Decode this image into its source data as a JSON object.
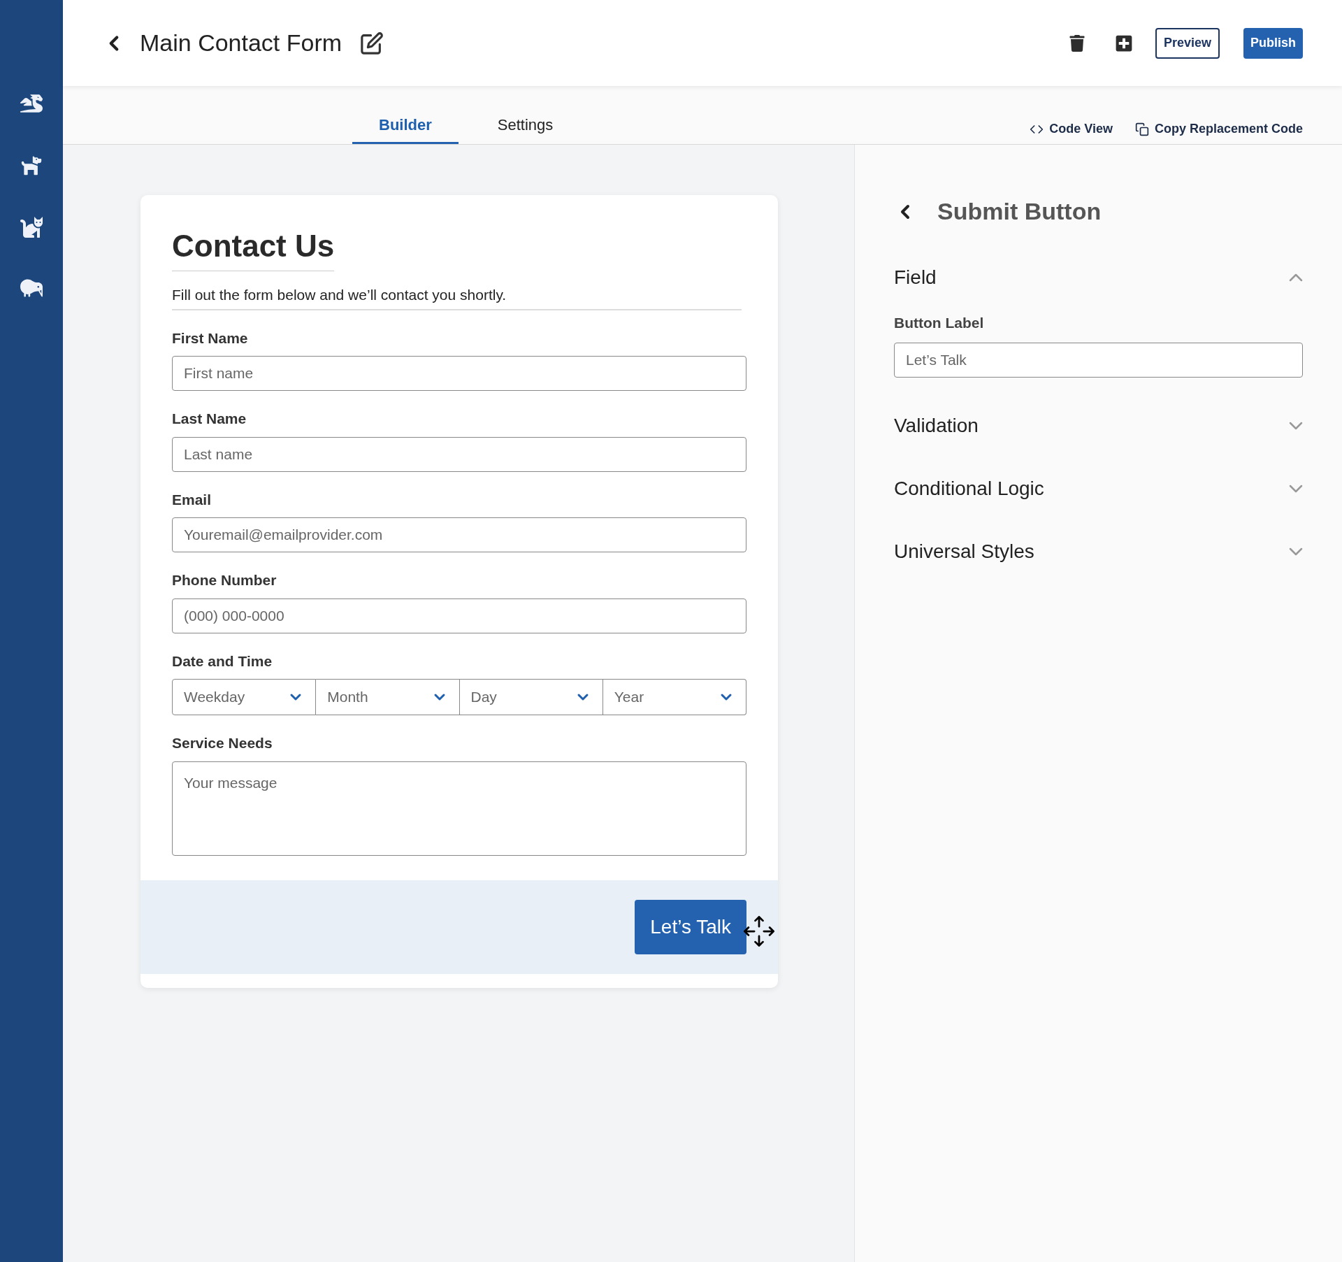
{
  "sidebar": {
    "items": [
      {
        "kind": "dragon"
      },
      {
        "kind": "dog"
      },
      {
        "kind": "cat"
      },
      {
        "kind": "kiwi"
      }
    ]
  },
  "header": {
    "title": "Main Contact Form",
    "buttons": [
      {
        "label": "Preview",
        "kind": "outline"
      },
      {
        "label": "Publish",
        "kind": "primary"
      }
    ]
  },
  "tabs": [
    {
      "label": "Builder",
      "selected": true
    },
    {
      "label": "Settings",
      "selected": false
    }
  ],
  "tab_actions": [
    {
      "label": "Code View",
      "kind": "code"
    },
    {
      "label": "Copy Replacement Code",
      "kind": "copy"
    }
  ],
  "form": {
    "title": "Contact Us",
    "description": "Fill out the form below and we’ll contact you shortly.",
    "fields": [
      {
        "kind": "text",
        "label": "First Name",
        "placeholder": "First name"
      },
      {
        "kind": "text",
        "label": "Last Name",
        "placeholder": "Last name"
      },
      {
        "kind": "text",
        "label": "Email",
        "placeholder": "Youremail@emailprovider.com"
      },
      {
        "kind": "text",
        "label": "Phone Number",
        "placeholder": "(000) 000-0000"
      },
      {
        "kind": "selects",
        "label": "Date and Time",
        "options": [
          "Weekday",
          "Month",
          "Day",
          "Year"
        ]
      },
      {
        "kind": "textarea",
        "label": "Service Needs",
        "placeholder": "Your message"
      }
    ],
    "submit": "Let’s Talk"
  },
  "panel": {
    "title": "Submit Button",
    "sections": [
      {
        "title": "Field",
        "expanded": true,
        "label": "Button Label",
        "value": "Let’s Talk"
      },
      {
        "title": "Validation",
        "expanded": false
      },
      {
        "title": "Conditional Logic",
        "expanded": false
      },
      {
        "title": "Universal Styles",
        "expanded": false
      }
    ]
  }
}
